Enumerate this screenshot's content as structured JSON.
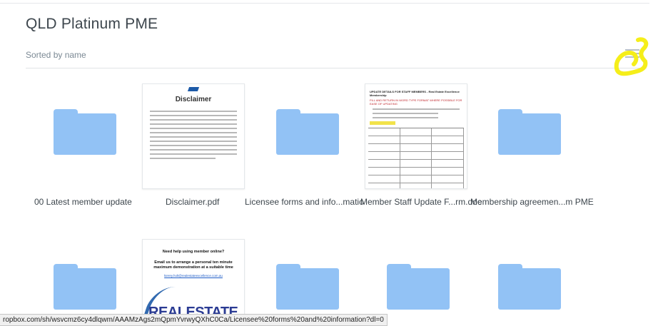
{
  "folder": {
    "title": "QLD Platinum PME"
  },
  "sort": {
    "label": "Sorted by name"
  },
  "items": [
    {
      "name": "00 Latest member update",
      "kind": "folder"
    },
    {
      "name": "Disclaimer.pdf",
      "kind": "pdf"
    },
    {
      "name": "Licensee forms and info...matio",
      "kind": "folder"
    },
    {
      "name": "Member Staff Update F...rm.doc",
      "kind": "doc"
    },
    {
      "name": "Membership agreemen...m PME",
      "kind": "folder"
    },
    {
      "name": "",
      "kind": "folder"
    },
    {
      "name": "",
      "kind": "image"
    },
    {
      "name": "",
      "kind": "folder"
    },
    {
      "name": "",
      "kind": "folder"
    },
    {
      "name": "",
      "kind": "folder"
    }
  ],
  "thumbs": {
    "disclaimer_title": "Disclaimer",
    "form_heading": "UPDATE DETAILS FOR STAFF MEMBERS - Real Estate Excellence Membership",
    "form_subheading": "FILL AND RETURN IN WORD TYPE FORMAT WHERE POSSIBLE FOR EASE OF UPDATING",
    "promo_heading": "Need help using member online?",
    "promo_body": "Email us to arrange a personal ten minute maximum demonstration at a suitable time",
    "promo_email": "kierey.holt@realestateexcellence.com.au",
    "promo_logo": "REALESTATE"
  },
  "status": {
    "url": "ropbox.com/sh/wsvcmz6cy4dlqwm/AAAMzAgs2mQpmYvrwyQXhC0Ca/Licensee%20forms%20and%20information?dl=0"
  },
  "colors": {
    "folder": "#92c2f5",
    "annotation": "#f5ee1a"
  }
}
